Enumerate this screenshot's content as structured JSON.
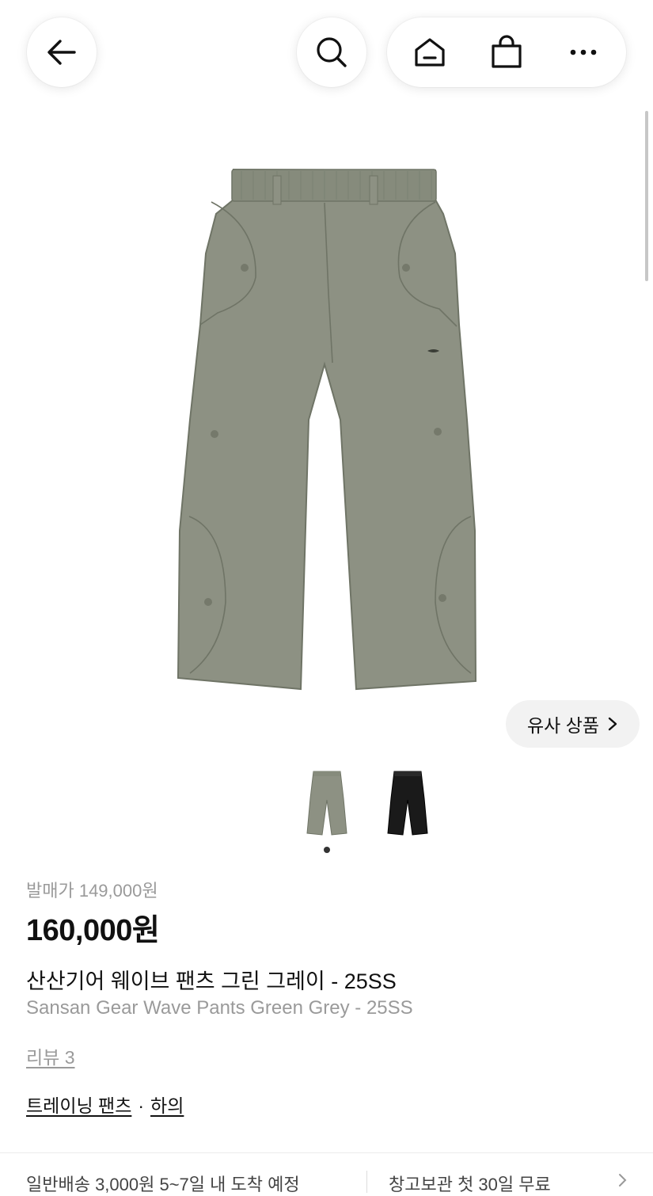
{
  "header": {
    "back_icon": "arrow-left-icon",
    "search_icon": "search-icon",
    "home_icon": "home-icon",
    "cart_icon": "shopping-bag-icon",
    "more_icon": "more-dots-icon"
  },
  "gallery": {
    "main_image": "green-grey-pants-photo",
    "similar_button_label": "유사 상품",
    "thumbnails": [
      {
        "color": "#8c9182",
        "label": "green-grey"
      },
      {
        "color": "#1a1a1a",
        "label": "black"
      }
    ],
    "active_index": 0
  },
  "product": {
    "release_price_label": "발매가 149,000원",
    "price": "160,000원",
    "name_ko": "산산기어 웨이브 팬츠 그린 그레이 - 25SS",
    "name_en": "Sansan Gear Wave Pants Green Grey - 25SS",
    "review_label": "리뷰 3",
    "category_primary": "트레이닝 팬츠",
    "category_separator": "·",
    "category_secondary": "하의"
  },
  "shipping": {
    "left_text": "일반배송 3,000원 5~7일 내 도착 예정",
    "right_text": "창고보관 첫 30일 무료"
  },
  "colors": {
    "pants_green_grey": "#8d9183",
    "pants_black": "#1a1a1a",
    "muted_text": "#9a9a9a"
  }
}
